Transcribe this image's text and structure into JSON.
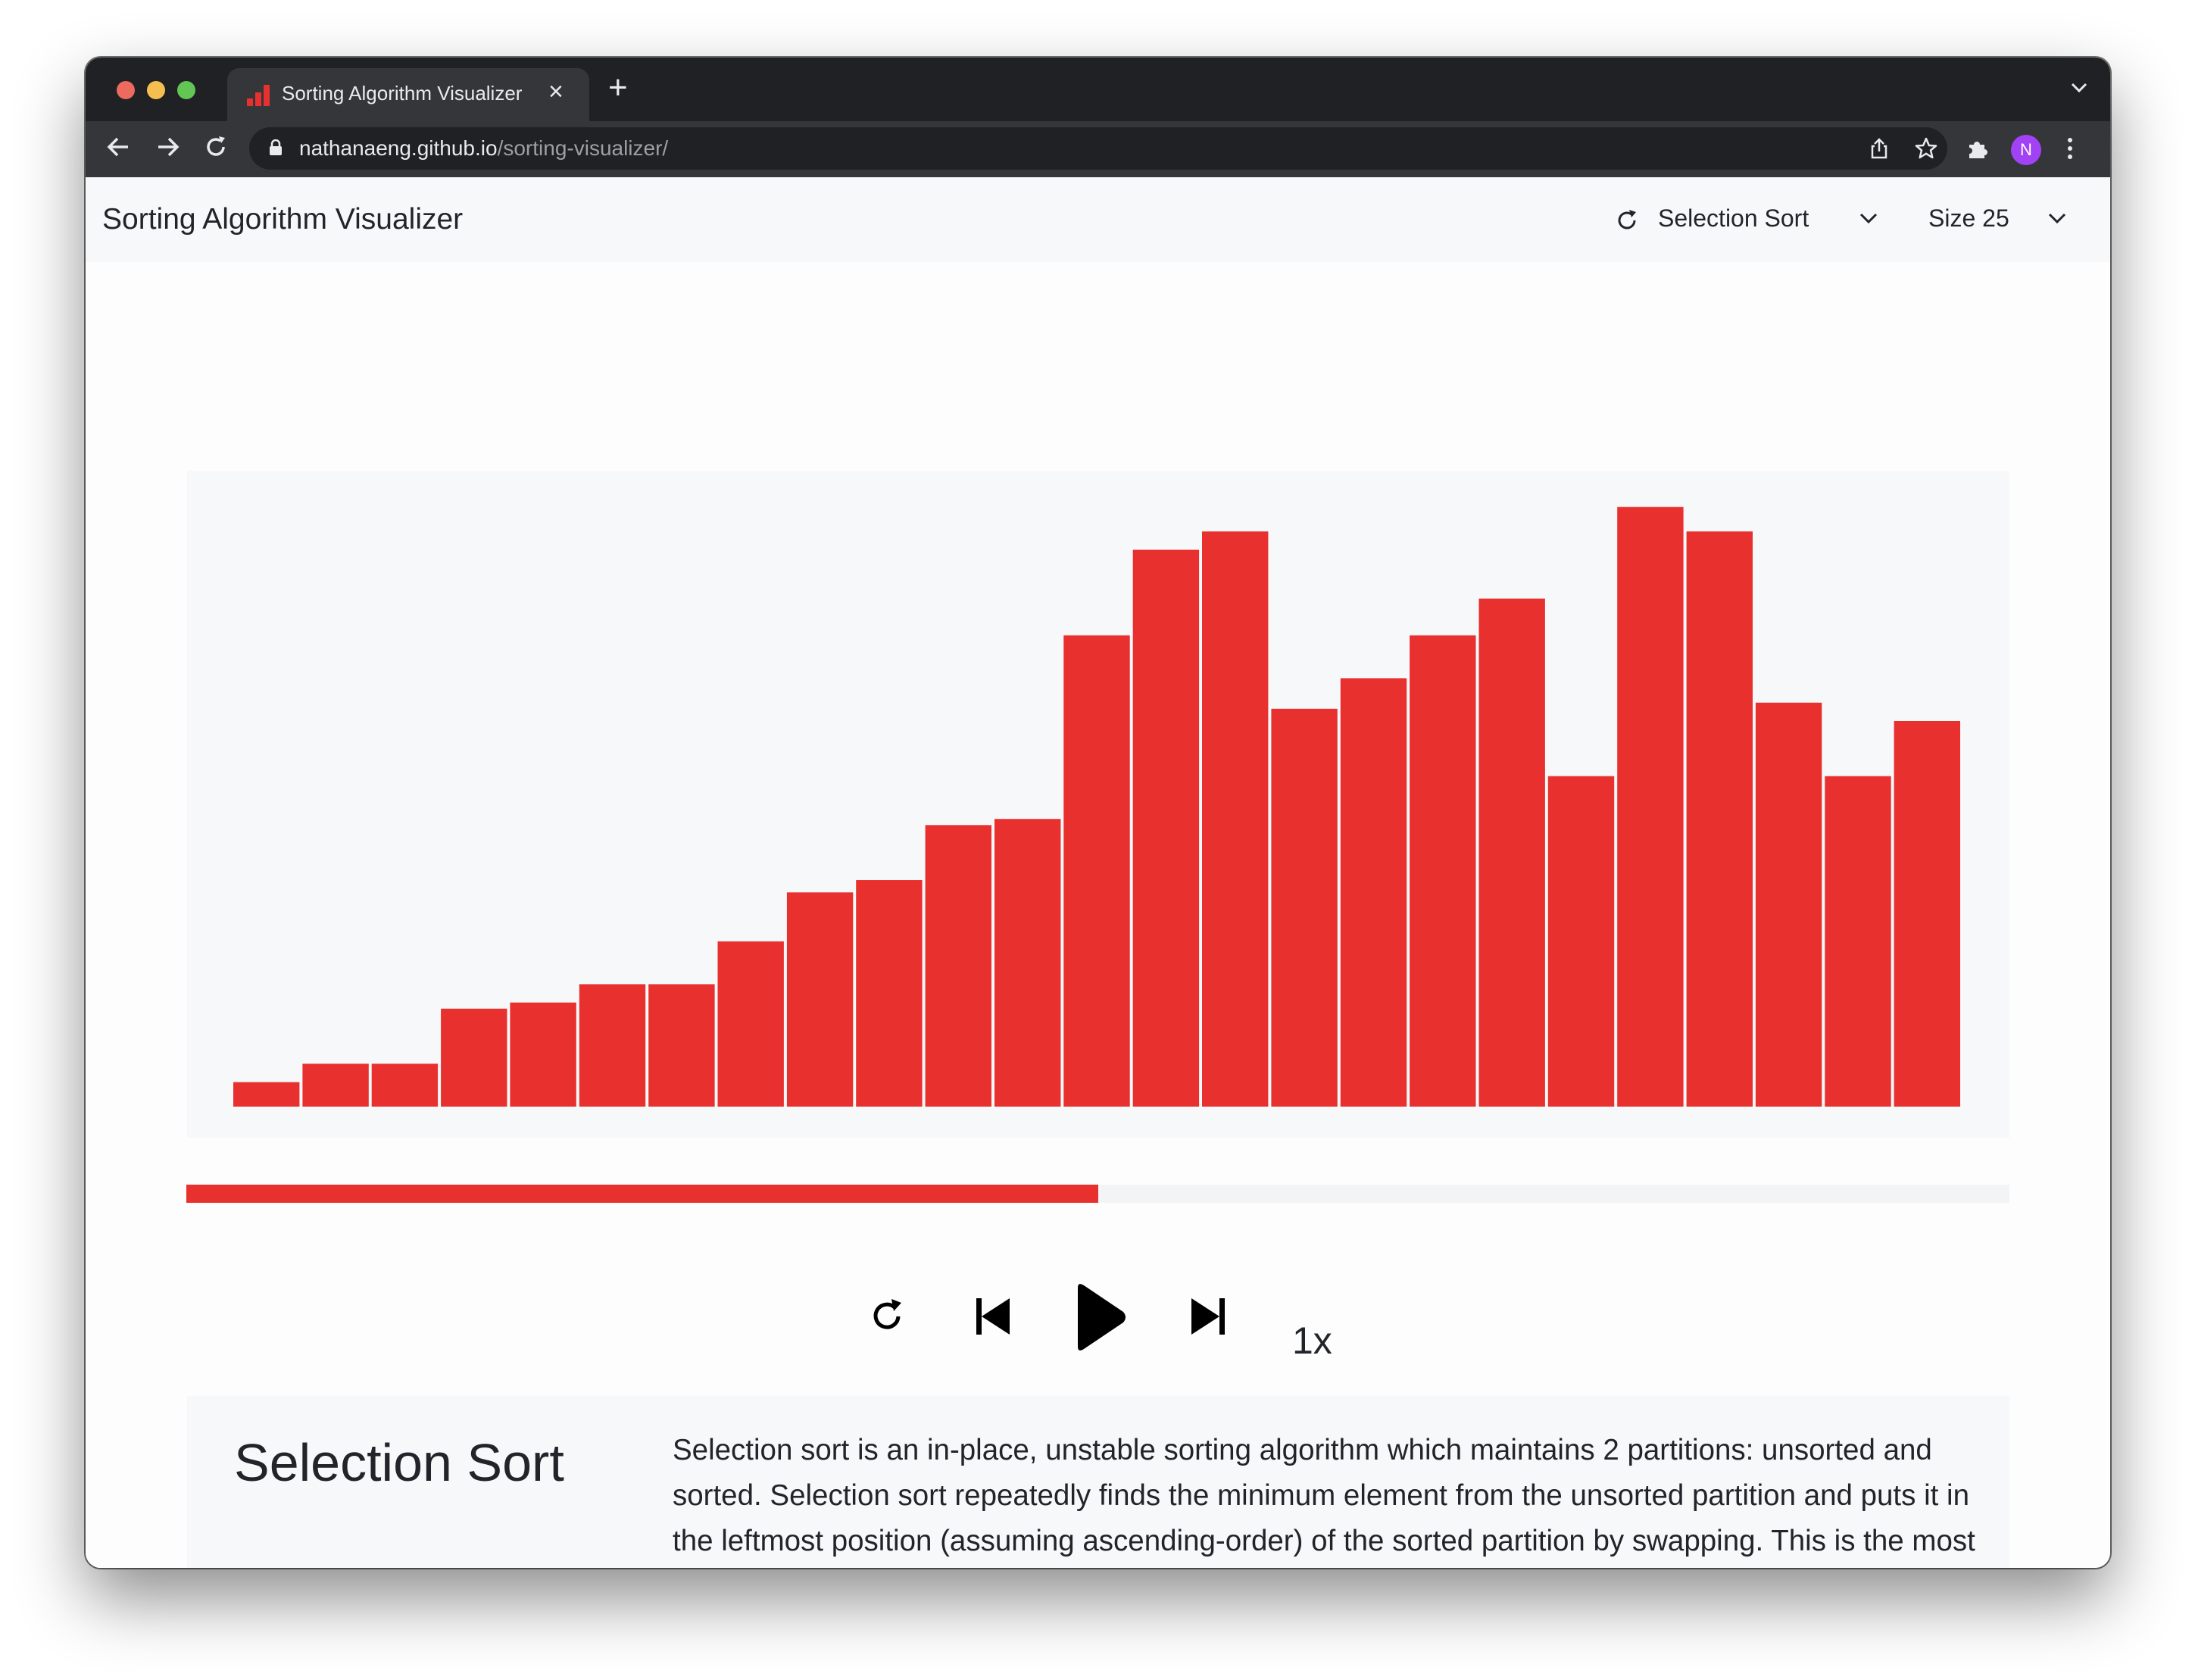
{
  "browser": {
    "tab_title": "Sorting Algorithm Visualizer",
    "url_host": "nathanaeng.github.io",
    "url_path": "/sorting-visualizer/",
    "profile_initial": "N",
    "accent_color": "#e8312f",
    "profile_color": "#a142f4"
  },
  "navbar": {
    "title": "Sorting Algorithm Visualizer",
    "algorithm": "Selection Sort",
    "size": "Size 25"
  },
  "chart_data": {
    "type": "bar",
    "title": "",
    "xlabel": "",
    "ylabel": "",
    "bar_color": "#e8312f",
    "ylim": [
      0,
      100
    ],
    "values": [
      4,
      7,
      7,
      16,
      17,
      20,
      20,
      27,
      35,
      37,
      46,
      47,
      77,
      91,
      94,
      65,
      70,
      77,
      83,
      54,
      98,
      94,
      66,
      54,
      63
    ]
  },
  "progress": {
    "fraction": 0.5
  },
  "controls": {
    "speed": "1x",
    "icons": [
      "reset-icon",
      "step-back-icon",
      "play-icon",
      "step-forward-icon"
    ]
  },
  "info": {
    "title": "Selection Sort",
    "description": "Selection sort is an in-place, unstable sorting algorithm which maintains 2 partitions: unsorted and sorted. Selection sort repeatedly finds the minimum element from the unsorted partition and puts it in the leftmost position (assuming ascending-order) of the sorted partition by swapping. This is the most common method of sorting playing cards in your hand."
  }
}
